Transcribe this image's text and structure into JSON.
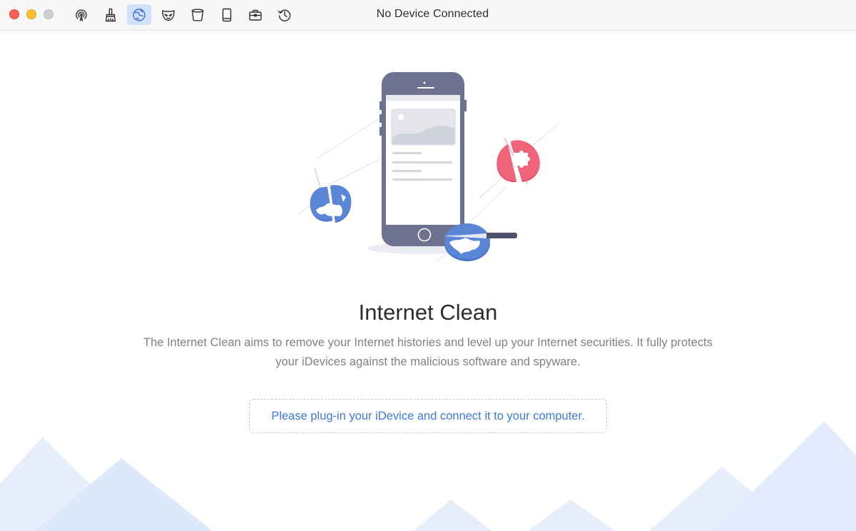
{
  "window": {
    "title": "No Device Connected"
  },
  "toolbar": {
    "tools": [
      {
        "name": "airbackup-icon",
        "active": false
      },
      {
        "name": "quick-clean-icon",
        "active": false
      },
      {
        "name": "internet-clean-icon",
        "active": true
      },
      {
        "name": "privacy-clean-icon",
        "active": false
      },
      {
        "name": "system-junk-icon",
        "active": false
      },
      {
        "name": "storage-icon",
        "active": false
      },
      {
        "name": "toolbox-icon",
        "active": false
      },
      {
        "name": "history-icon",
        "active": false
      }
    ]
  },
  "main": {
    "heading": "Internet Clean",
    "description": "The Internet Clean aims to remove your Internet histories and level up your Internet securities. It fully protects your iDevices against the malicious software and spyware.",
    "connect_prompt": "Please plug-in your iDevice and connect it to your computer."
  },
  "colors": {
    "accent": "#3d7bd9",
    "active_tool_bg": "#cfe1fb",
    "phone_body": "#6e7190",
    "badge_blue": "#5b86d8",
    "badge_red": "#ef6478",
    "mountain": "#e4edfb"
  }
}
